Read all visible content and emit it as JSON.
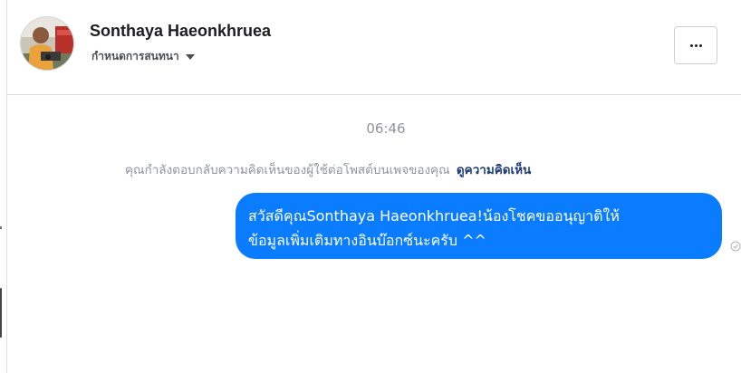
{
  "header": {
    "contact_name": "Sonthaya Haeonkhruea",
    "conversation_setting_label": "กำหนดการสนทนา",
    "more_button_label": "..."
  },
  "conversation": {
    "timestamp": "06:46",
    "context_text": "คุณกำลังตอบกลับความคิดเห็นของผู้ใช้ต่อโพสต์บนเพจของคุณ",
    "context_link": "ดูความคิดเห็น",
    "message": {
      "line1": "สวัสดีคุณSonthaya Haeonkhruea!น้องโชคขออนุญาติให้",
      "line2": "ข้อมูลเพิ่มเติมทางอินบ๊อกซ์นะครับ ^^",
      "status_icon": "seen-check-icon"
    }
  },
  "colors": {
    "bubble_bg": "#0a7cff",
    "link": "#1c3d7a",
    "muted_text": "#90949c"
  }
}
